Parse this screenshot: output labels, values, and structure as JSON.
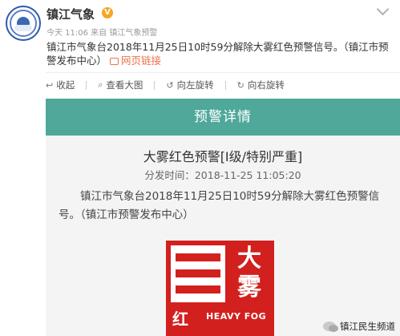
{
  "post": {
    "account_name": "镇江气象",
    "verified_badge": "V",
    "meta": "今天 11:06 来自 镇江气象预警",
    "text_main": "镇江市气象台2018年11月25日10时59分解除大雾红色预警信号。（镇江市预警发布中心）",
    "web_link_label": "网页链接"
  },
  "toolbar": {
    "collapse_label": "收起",
    "view_large_label": "查看大图",
    "rotate_left_label": "向左旋转",
    "rotate_right_label": "向右旋转"
  },
  "warning_card": {
    "header": "预警详情",
    "title": "大雾红色预警[Ⅰ级/特别严重]",
    "issued_time": "分发时间：2018-11-25  11:05:20",
    "body": "镇江市气象台2018年11月25日10时59分解除大雾红色预警信号。（镇江市预警发布中心）"
  },
  "fog_badge": {
    "char_top": "大",
    "char_bottom": "雾",
    "level_char": "红",
    "english": "HEAVY FOG",
    "color": "#d2201e"
  },
  "watermark": {
    "text": "镇江民生频道"
  },
  "colors": {
    "link": "#eb7350",
    "warning_bar": "#4fa89a"
  },
  "icons": [
    "weather-bureau-avatar",
    "verified-icon",
    "chevron-down-icon",
    "link-icon",
    "collapse-icon",
    "view-large-icon",
    "rotate-left-icon",
    "rotate-right-icon",
    "wechat-icon"
  ]
}
